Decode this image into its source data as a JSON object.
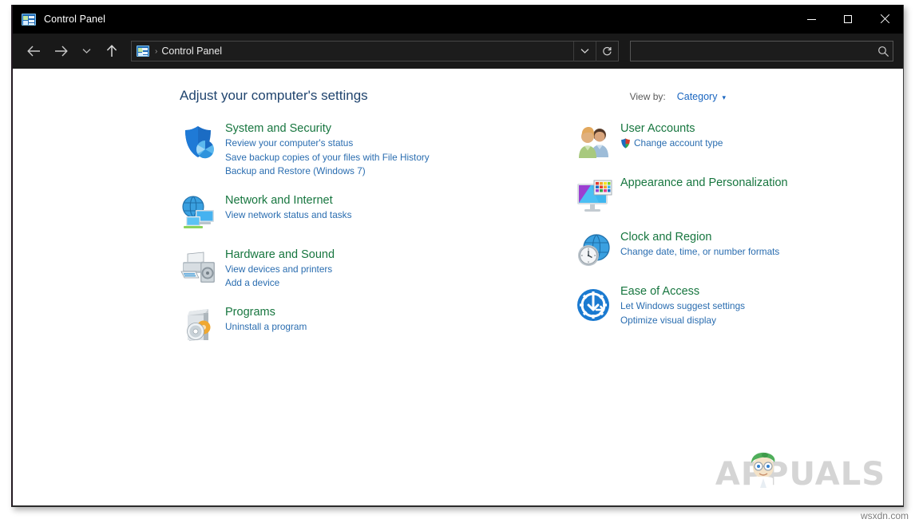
{
  "window": {
    "title": "Control Panel",
    "title_icon": "control-panel-icon",
    "buttons": {
      "minimize": "minimize-icon",
      "maximize": "maximize-icon",
      "close": "close-icon"
    }
  },
  "navbar": {
    "back": "back-arrow-icon",
    "forward": "forward-arrow-icon",
    "recent": "chevron-down-icon",
    "up": "up-arrow-icon",
    "address": {
      "icon": "control-panel-icon",
      "separator": "›",
      "text": "Control Panel",
      "dropdown": "chevron-down-icon",
      "refresh": "refresh-icon"
    },
    "search": {
      "value": "",
      "placeholder": "",
      "icon": "search-icon"
    }
  },
  "main": {
    "page_title": "Adjust your computer's settings",
    "view_by": {
      "label": "View by:",
      "value": "Category",
      "caret": "▾"
    },
    "columns": [
      {
        "side": "left",
        "categories": [
          {
            "icon": "security-shield-icon",
            "title": "System and Security",
            "links": [
              {
                "text": "Review your computer's status",
                "shield": false
              },
              {
                "text": "Save backup copies of your files with File History",
                "shield": false
              },
              {
                "text": "Backup and Restore (Windows 7)",
                "shield": false
              }
            ]
          },
          {
            "icon": "network-globe-icon",
            "title": "Network and Internet",
            "links": [
              {
                "text": "View network status and tasks",
                "shield": false
              }
            ]
          },
          {
            "icon": "printer-speaker-icon",
            "title": "Hardware and Sound",
            "links": [
              {
                "text": "View devices and printers",
                "shield": false
              },
              {
                "text": "Add a device",
                "shield": false
              }
            ]
          },
          {
            "icon": "program-box-cd-icon",
            "title": "Programs",
            "links": [
              {
                "text": "Uninstall a program",
                "shield": false
              }
            ]
          }
        ]
      },
      {
        "side": "right",
        "categories": [
          {
            "icon": "user-accounts-people-icon",
            "title": "User Accounts",
            "links": [
              {
                "text": "Change account type",
                "shield": true
              }
            ]
          },
          {
            "icon": "monitor-palette-icon",
            "title": "Appearance and Personalization",
            "links": []
          },
          {
            "icon": "clock-globe-icon",
            "title": "Clock and Region",
            "links": [
              {
                "text": "Change date, time, or number formats",
                "shield": false
              }
            ]
          },
          {
            "icon": "ease-of-access-icon",
            "title": "Ease of Access",
            "links": [
              {
                "text": "Let Windows suggest settings",
                "shield": false
              },
              {
                "text": "Optimize visual display",
                "shield": false
              }
            ]
          }
        ]
      }
    ]
  },
  "watermark": {
    "text": "APPUALS",
    "mascot": "appuals-mascot-icon"
  },
  "footer_watermark": "wsxdn.com",
  "colors": {
    "titlebar_bg": "#000000",
    "navbar_bg": "#191919",
    "page_title": "#21456f",
    "category_title": "#17763f",
    "link": "#2a6db0",
    "viewby_value": "#1a66c0"
  }
}
